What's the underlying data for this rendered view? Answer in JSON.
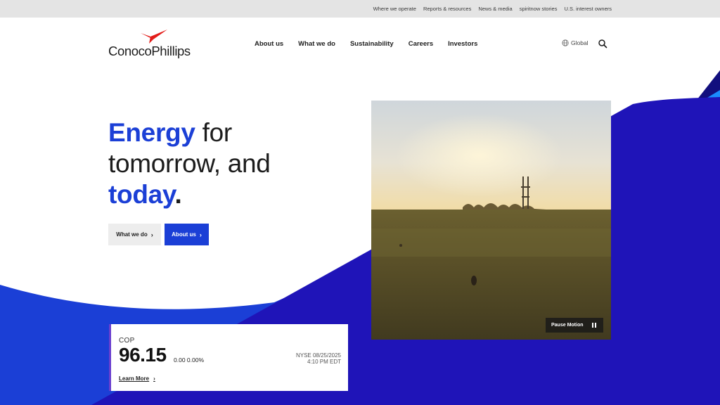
{
  "utility_nav": [
    "Where we operate",
    "Reports & resources",
    "News & media",
    "spiritnow stories",
    "U.S. interest owners"
  ],
  "logo": {
    "text": "ConocoPhillips",
    "brand_red": "#e31d1a"
  },
  "main_nav": [
    "About us",
    "What we do",
    "Sustainability",
    "Careers",
    "Investors"
  ],
  "region": {
    "label": "Global",
    "icon": "globe-icon"
  },
  "search": {
    "icon": "search-icon"
  },
  "hero": {
    "title_accent_1": "Energy",
    "title_rest_1": " for",
    "title_line_2": "tomorrow, and",
    "title_accent_3": "today",
    "title_dot": ".",
    "buttons": {
      "primary_secondary": "What we do",
      "primary": "About us"
    }
  },
  "media": {
    "pause_label": "Pause Motion",
    "pause_icon": "pause-icon"
  },
  "stock": {
    "ticker": "COP",
    "price": "96.15",
    "change": "0.00 0.00%",
    "exchange_line1": "NYSE 08/25/2025",
    "exchange_line2": "4:10 PM EDT",
    "learn_more": "Learn More"
  },
  "colors": {
    "accent_blue": "#1b3fd6",
    "deep_blue": "#1f14b8",
    "navy": "#120f7e",
    "sky_blue": "#1a8cff",
    "card_accent": "#6a3fcf"
  }
}
